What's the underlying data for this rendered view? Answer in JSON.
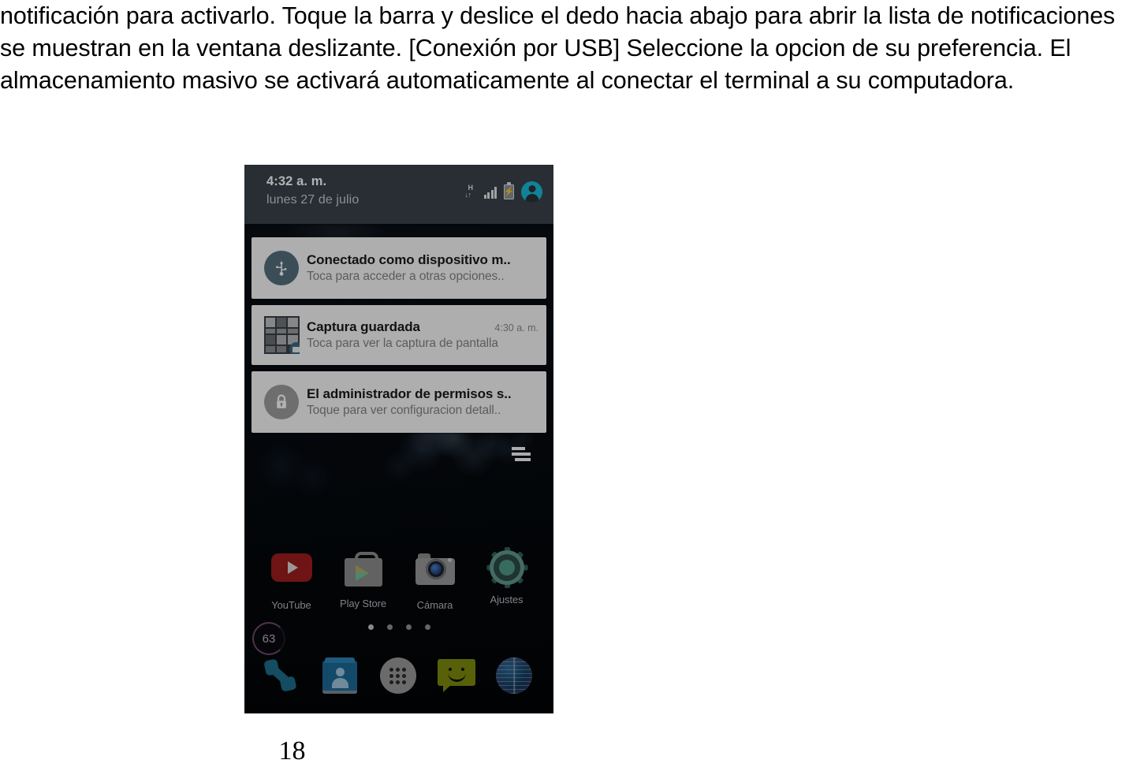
{
  "manual": {
    "body_text": "notificación para activarlo. Toque la barra y deslice el dedo hacia abajo para abrir la lista de notificaciones se muestran en la ventana deslizante. [Conexión por USB] Seleccione la opcion de su preferencia. El almacenamiento masivo se activará automaticamente al conectar el terminal a su computadora.",
    "page_number": "18"
  },
  "phone": {
    "status_bar": {
      "clock": "4:32 a. m.",
      "date": "lunes 27 de julio",
      "data_letter": "H",
      "data_arrows": "↓↑",
      "battery_bolt": "⚡",
      "icons": [
        "hspa-data-icon",
        "signal-bars-icon",
        "battery-charging-icon",
        "user-avatar-icon"
      ],
      "panel_color": "#3b434b",
      "avatar_color": "#16bedb"
    },
    "notifications": [
      {
        "id": "usb-connection",
        "icon": "usb-icon",
        "icon_bg": "#55707f",
        "title": "Conectado como dispositivo m..",
        "subtitle": "Toca para acceder a otras opciones..",
        "time": ""
      },
      {
        "id": "screenshot-saved",
        "icon": "screenshot-thumbnail-icon",
        "icon_bg": "#3a3f45",
        "title": "Captura guardada",
        "subtitle": "Toca para ver la captura de pantalla",
        "time": "4:30 a. m."
      },
      {
        "id": "permission-manager",
        "icon": "lock-icon",
        "icon_bg": "#9e9e9e",
        "title": "El administrador de permisos s..",
        "subtitle": "Toque para ver configuracion detall..",
        "time": ""
      }
    ],
    "home_screen": {
      "widget_progress_value": "63",
      "page_dots_count": 4,
      "page_dots_active_index": 0,
      "apps": [
        {
          "label": "YouTube",
          "icon": "youtube-icon"
        },
        {
          "label": "Play Store",
          "icon": "play-store-icon"
        },
        {
          "label": "Cámara",
          "icon": "camera-icon"
        },
        {
          "label": "Ajustes",
          "icon": "settings-gear-icon"
        }
      ],
      "dock": [
        {
          "icon": "phone-icon"
        },
        {
          "icon": "contacts-icon"
        },
        {
          "icon": "app-drawer-icon"
        },
        {
          "icon": "messaging-icon"
        },
        {
          "icon": "browser-icon"
        }
      ]
    }
  }
}
